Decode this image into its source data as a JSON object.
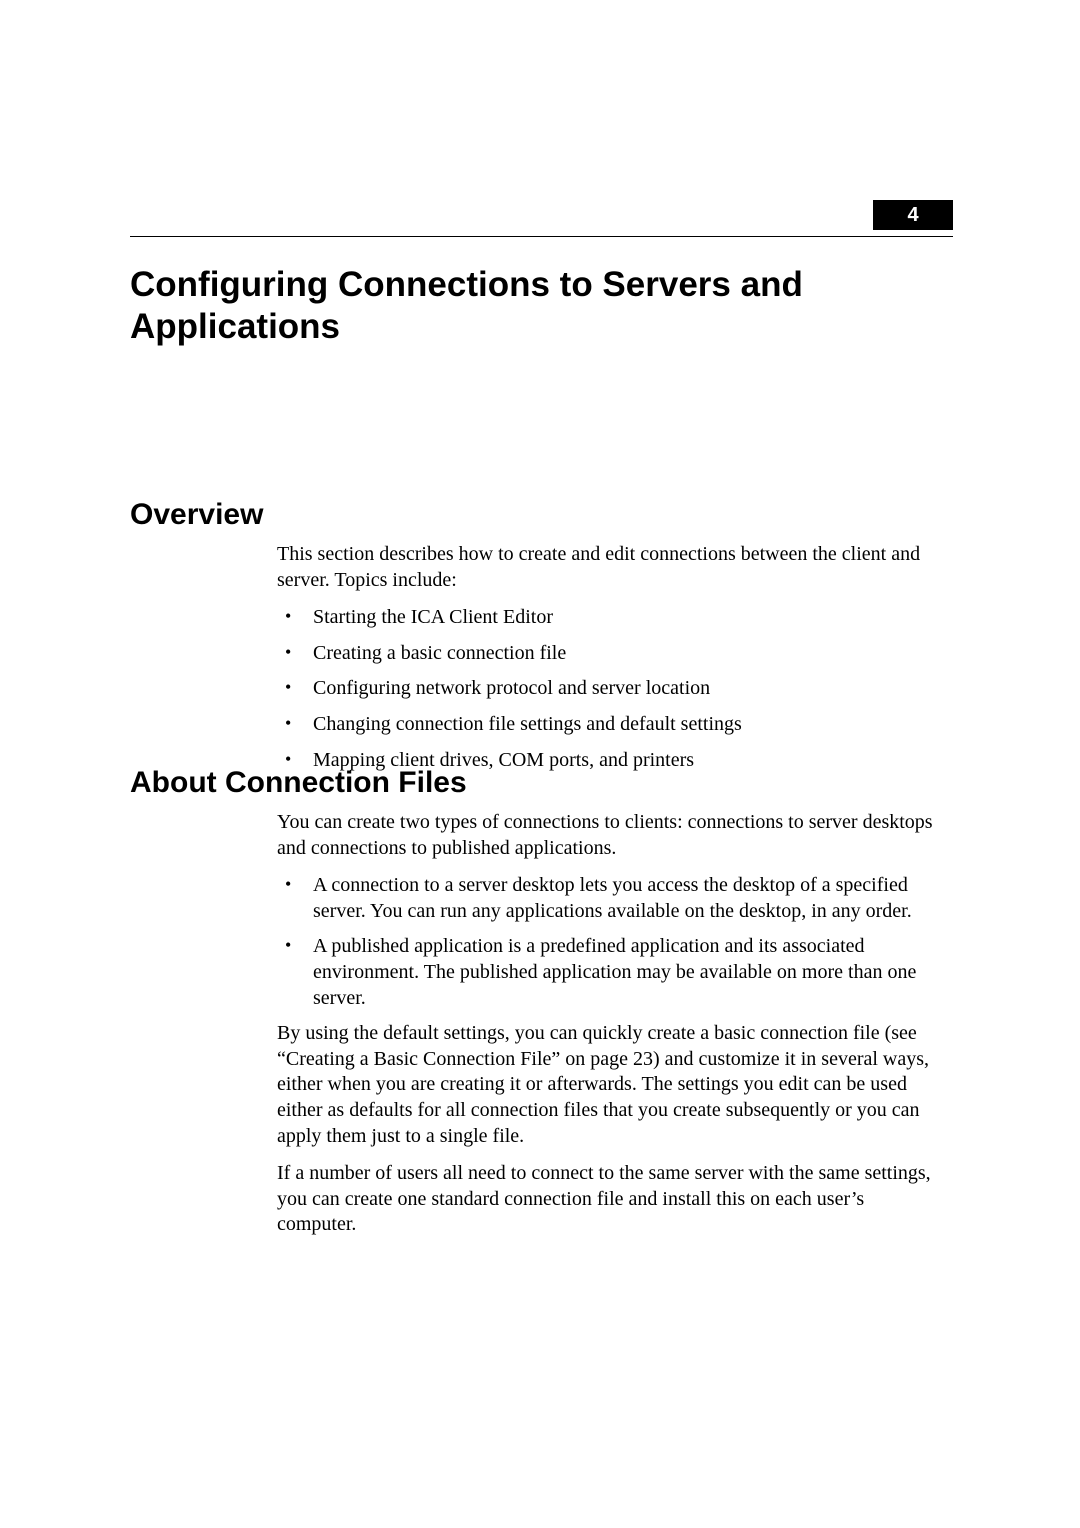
{
  "chapter": {
    "number": "4",
    "title": "Configuring Connections to Servers and Applications"
  },
  "sections": {
    "overview": {
      "heading": "Overview",
      "intro": "This section describes how to create and edit connections between the client and server. Topics include:",
      "bullets": [
        "Starting the ICA Client Editor",
        "Creating a basic connection file",
        "Configuring network protocol and server location",
        "Changing connection file settings and default settings",
        "Mapping client drives, COM ports, and printers"
      ]
    },
    "about": {
      "heading": "About Connection Files",
      "intro": "You can create two types of connections to clients: connections to server desktops and connections to published applications.",
      "bullets": [
        "A connection to a server desktop lets you access the desktop of a specified server. You can run any applications available on the desktop, in any order.",
        "A published application is a predefined application and its associated environment. The published application may be available on more than one server."
      ],
      "para1": "By using the default settings, you can quickly create a basic connection file (see “Creating a Basic Connection File” on page 23) and customize it in several ways, either when you are creating it or afterwards. The settings you edit can be used either as defaults for all connection files that you create subsequently or you can apply them just to a single file.",
      "para2": "If a number of users all need to connect to the same server with the same settings, you can create one standard connection file and install this on each user’s computer."
    }
  }
}
